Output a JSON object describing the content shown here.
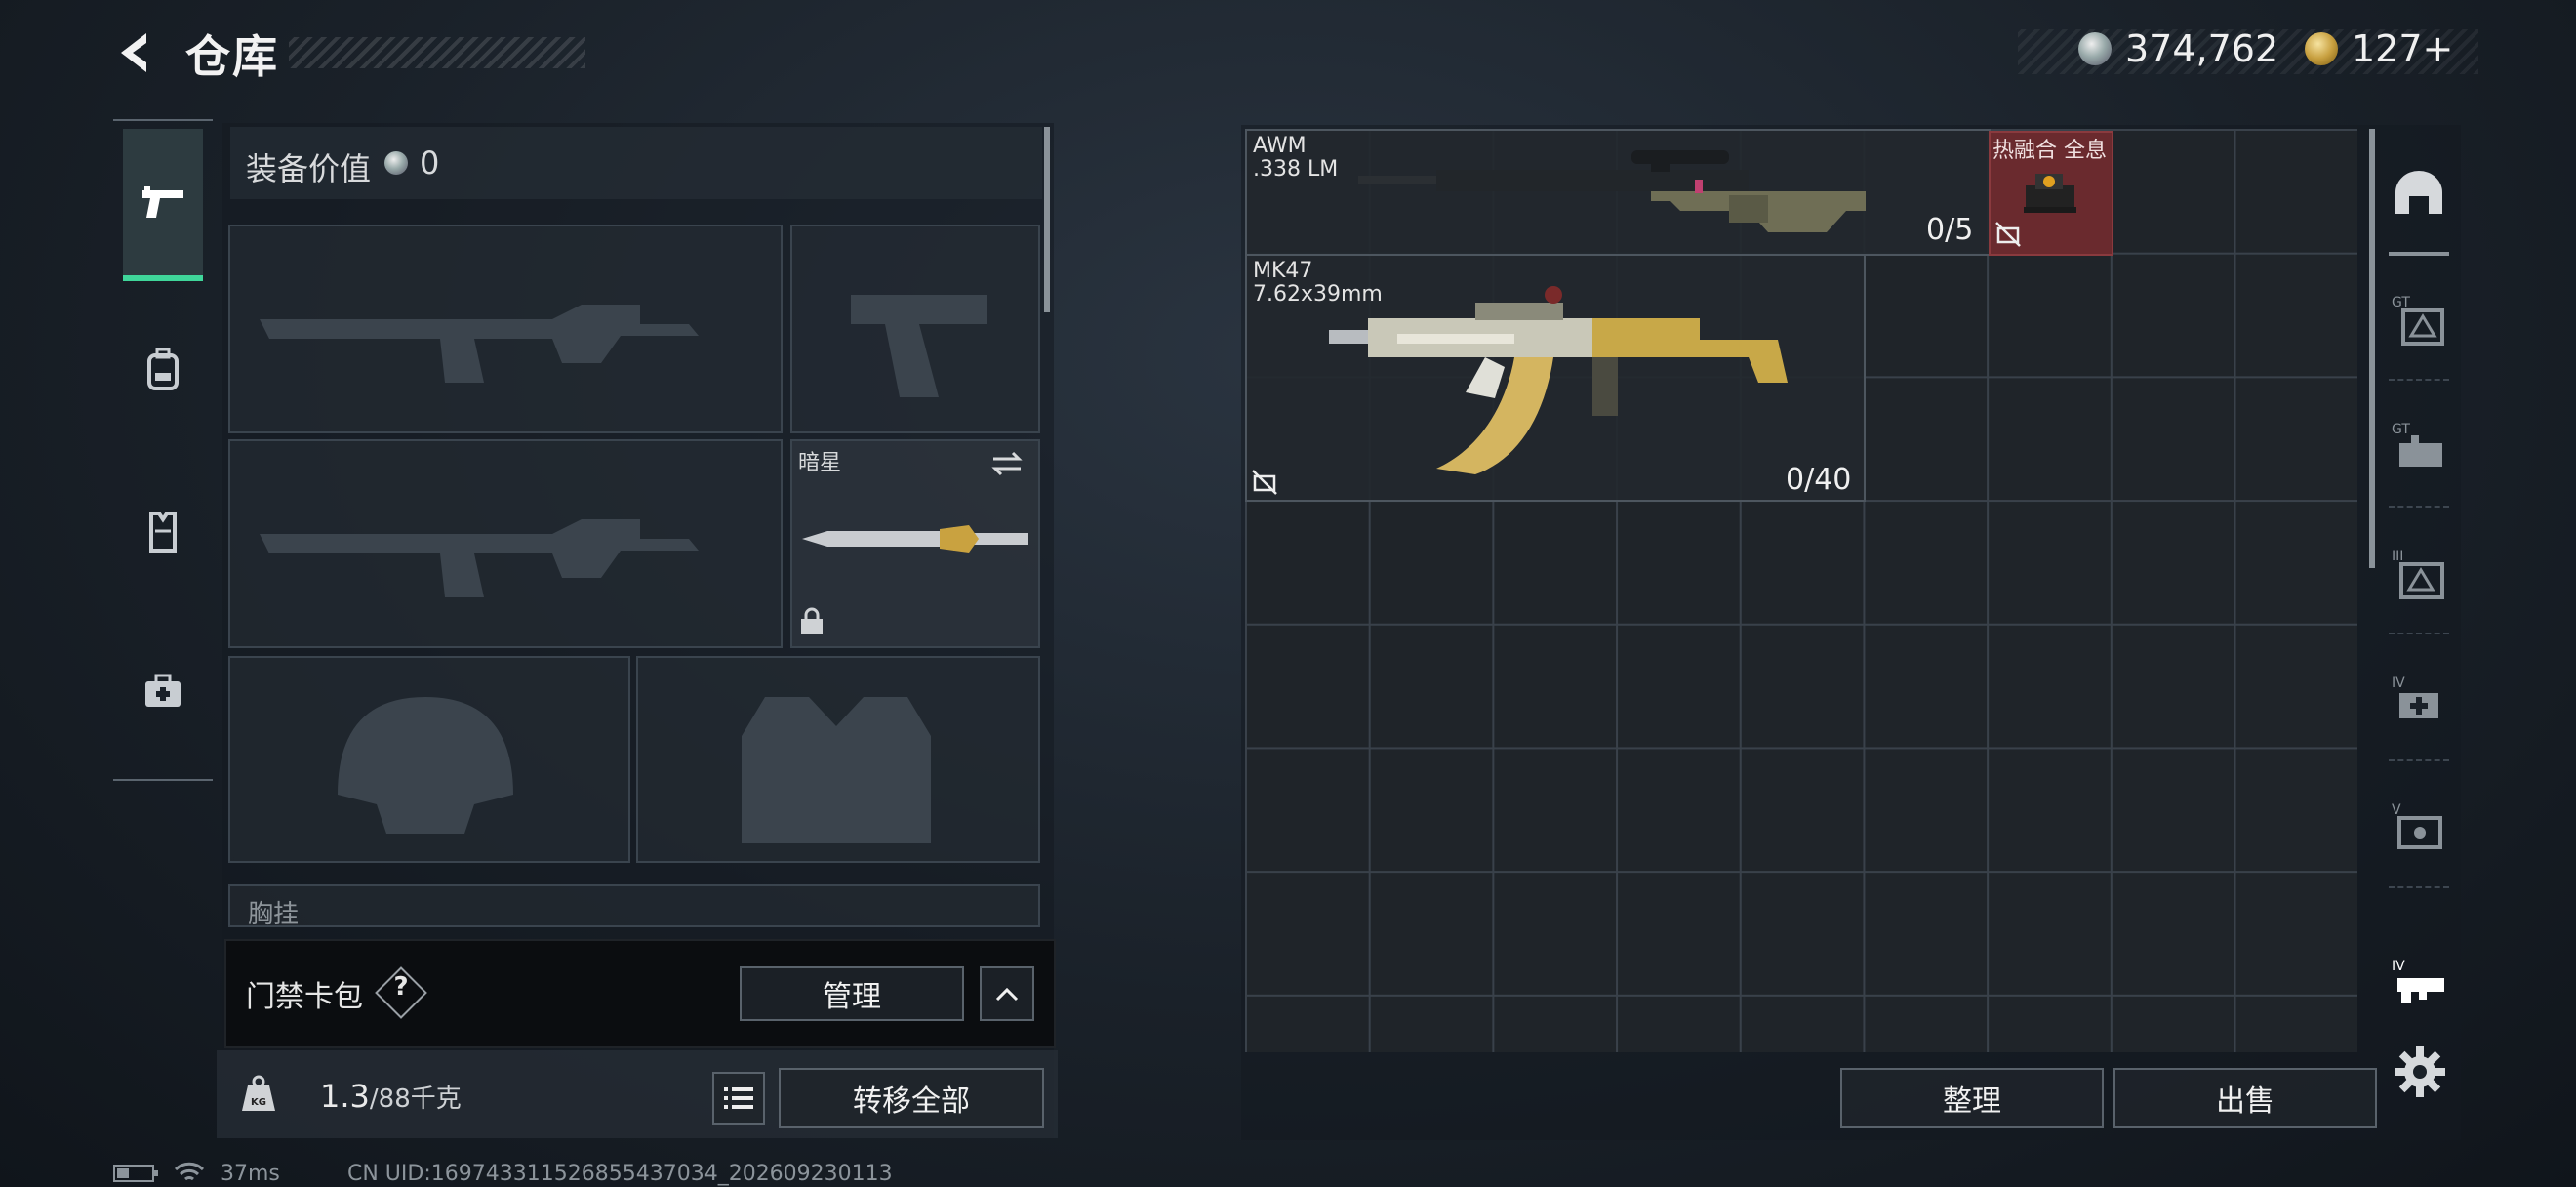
{
  "header": {
    "title": "仓库",
    "silver_amount": "374,762",
    "gold_amount": "127+"
  },
  "left_tabs": [
    {
      "name": "pistol-icon",
      "active": true
    },
    {
      "name": "backpack-icon",
      "active": false
    },
    {
      "name": "vest-icon",
      "active": false
    },
    {
      "name": "medkit-icon",
      "active": false
    }
  ],
  "equipment": {
    "value_label": "装备价值",
    "value": "0",
    "melee_label": "暗星",
    "next_section_label": "胸挂"
  },
  "card_bag": {
    "label": "门禁卡包",
    "help": "?",
    "manage_label": "管理"
  },
  "weight": {
    "current": "1.3",
    "max": "/88千克",
    "transfer_all_label": "转移全部"
  },
  "storage_items": [
    {
      "name": "AWM",
      "caliber": ".338 LM",
      "ammo": "0/5"
    },
    {
      "name": "MK47",
      "caliber": "7.62x39mm",
      "ammo": "0/40"
    }
  ],
  "hot_item": {
    "label": "热融合 全息"
  },
  "storage_actions": {
    "sort_label": "整理",
    "sell_label": "出售"
  },
  "right_categories": [
    "helmet-icon",
    "gt-i-icon",
    "gt-ii-icon",
    "iii-icon",
    "iv-medical-icon",
    "v-icon",
    "iv-gun-icon"
  ],
  "status": {
    "ping": "37ms",
    "uid": "CN UID:1697433115268554370​34_202609230113"
  },
  "colors": {
    "accent": "#3fd69a",
    "hot_bg": "#6a2a2e"
  }
}
